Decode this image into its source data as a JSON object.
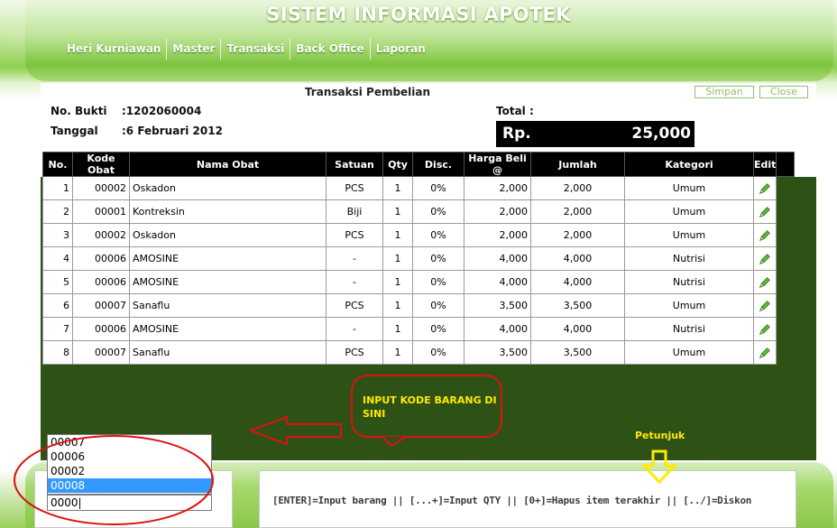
{
  "app": {
    "title": "SISTEM INFORMASI APOTEK"
  },
  "nav": {
    "items": [
      "Heri Kurniawan",
      "Master",
      "Transaksi",
      "Back Office",
      "Laporan"
    ]
  },
  "form": {
    "title": "Transaksi Pembelian",
    "simpan_label": "Simpan",
    "close_label": "Close",
    "no_bukti_label": "No. Bukti",
    "no_bukti_value": ":1202060004",
    "tanggal_label": "Tanggal",
    "tanggal_value": ":6 Februari 2012",
    "total_label": "Total :",
    "total_currency": "Rp.",
    "total_amount": "25,000"
  },
  "table": {
    "headers": [
      "No.",
      "Kode Obat",
      "Nama Obat",
      "Satuan",
      "Qty",
      "Disc.",
      "Harga Beli @",
      "Jumlah",
      "Kategori",
      "Edit"
    ],
    "rows": [
      [
        "1",
        "00002",
        "Oskadon",
        "PCS",
        "1",
        "0%",
        "2,000",
        "2,000",
        "Umum"
      ],
      [
        "2",
        "00001",
        "Kontreksin",
        "Biji",
        "1",
        "0%",
        "2,000",
        "2,000",
        "Umum"
      ],
      [
        "3",
        "00002",
        "Oskadon",
        "PCS",
        "1",
        "0%",
        "2,000",
        "2,000",
        "Umum"
      ],
      [
        "4",
        "00006",
        "AMOSINE",
        "-",
        "1",
        "0%",
        "4,000",
        "4,000",
        "Nutrisi"
      ],
      [
        "5",
        "00006",
        "AMOSINE",
        "-",
        "1",
        "0%",
        "4,000",
        "4,000",
        "Nutrisi"
      ],
      [
        "6",
        "00007",
        "Sanaflu",
        "PCS",
        "1",
        "0%",
        "3,500",
        "3,500",
        "Umum"
      ],
      [
        "7",
        "00006",
        "AMOSINE",
        "-",
        "1",
        "0%",
        "4,000",
        "4,000",
        "Nutrisi"
      ],
      [
        "8",
        "00007",
        "Sanaflu",
        "PCS",
        "1",
        "0%",
        "3,500",
        "3,500",
        "Umum"
      ]
    ]
  },
  "annotations": {
    "callout": "INPUT KODE BARANG DI SINI",
    "petunjuk": "Petunjuk"
  },
  "hint": "[ENTER]=Input barang || [...+]=Input QTY || [0+]=Hapus item terakhir || [../]=Diskon",
  "autocomplete": {
    "options": [
      "00007",
      "00006",
      "00002",
      "00008"
    ],
    "selected_index": 3,
    "input_value": "0000"
  },
  "colors": {
    "accent": "#7cc43d",
    "dark_panel": "#2e5216",
    "annotation_red": "#e01010",
    "annotation_yellow": "#ffeb00",
    "selection": "#3399ff"
  }
}
